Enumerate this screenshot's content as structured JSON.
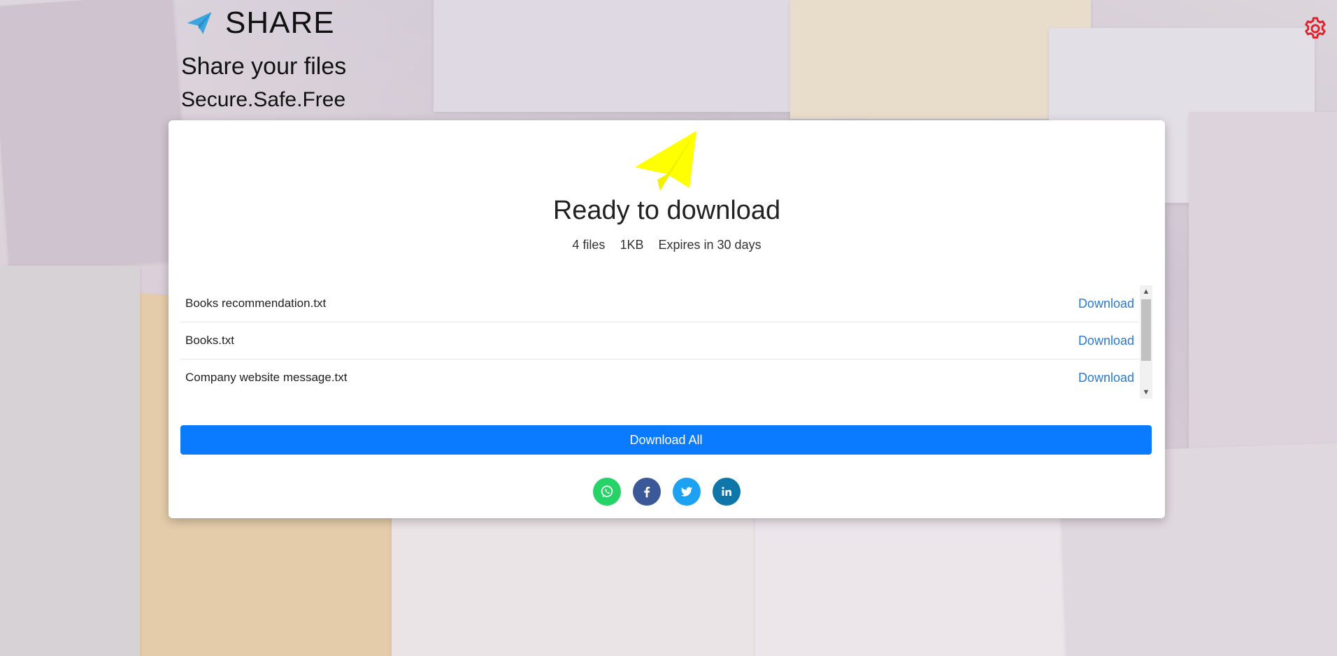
{
  "brand": {
    "title": "SHARE",
    "icon": "paper-plane-icon",
    "icon_color": "#3aa6e0"
  },
  "header": {
    "tagline": "Share your files",
    "subtagline": "Secure.Safe.Free"
  },
  "settings": {
    "icon": "gear-icon",
    "color": "#e0202a"
  },
  "card": {
    "hero_icon": "paper-plane-icon",
    "hero_color": "#ffff00",
    "title": "Ready to download",
    "file_count": "4 files",
    "size": "1KB",
    "expiry": "Expires in 30 days"
  },
  "files": [
    {
      "name": "Books recommendation.txt",
      "action": "Download"
    },
    {
      "name": "Books.txt",
      "action": "Download"
    },
    {
      "name": "Company website message.txt",
      "action": "Download"
    }
  ],
  "download_all_label": "Download All",
  "social": [
    {
      "name": "whatsapp",
      "icon": "whatsapp-icon",
      "color": "#25d366"
    },
    {
      "name": "facebook",
      "icon": "facebook-icon",
      "color": "#3b5998"
    },
    {
      "name": "twitter",
      "icon": "twitter-icon",
      "color": "#1da1f2"
    },
    {
      "name": "linkedin",
      "icon": "linkedin-icon",
      "color": "#0e76a8"
    }
  ]
}
